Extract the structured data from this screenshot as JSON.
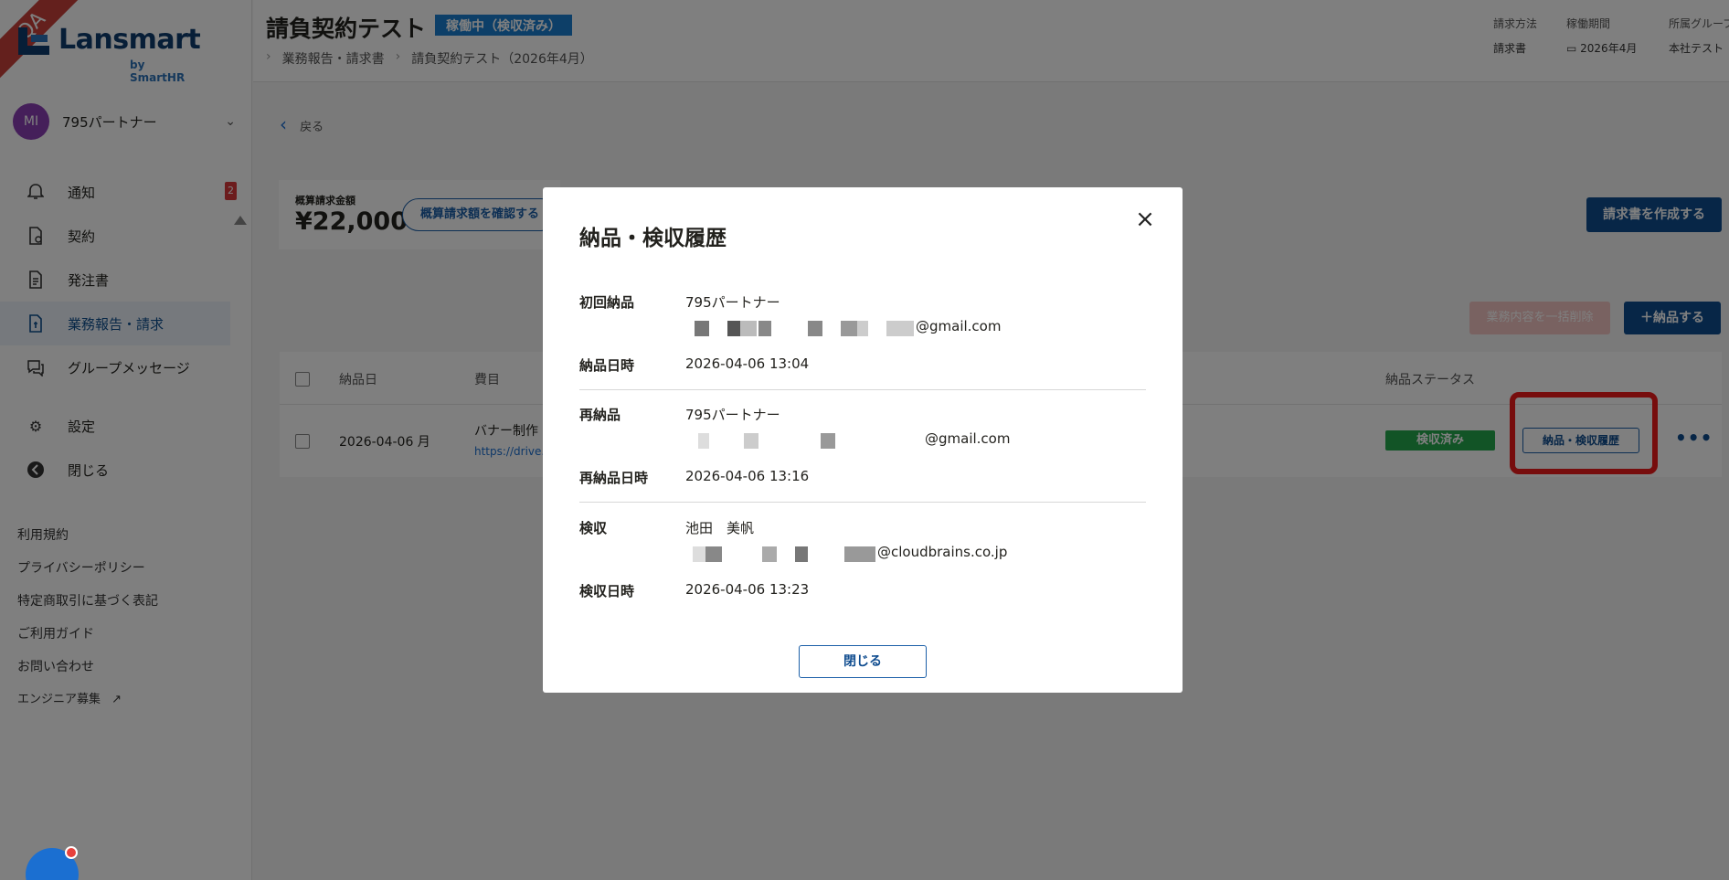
{
  "app": {
    "brand": "Lansmart",
    "brand_sub": "by SmartHR",
    "env_ribbon": "QA"
  },
  "account": {
    "initials": "MI",
    "name": "795パートナー"
  },
  "sidebar": {
    "items": [
      {
        "label": "通知",
        "icon": "bell-icon",
        "badge": "2"
      },
      {
        "label": "契約",
        "icon": "contract-icon"
      },
      {
        "label": "発注書",
        "icon": "document-icon"
      },
      {
        "label": "業務報告・請求",
        "icon": "report-icon",
        "active": true
      },
      {
        "label": "グループメッセージ",
        "icon": "chat-icon"
      },
      {
        "label": "設定",
        "icon": "gear-icon"
      },
      {
        "label": "閉じる",
        "icon": "close-circle-icon"
      }
    ],
    "links": [
      "利用規約",
      "プライバシーポリシー",
      "特定商取引に基づく表記",
      "ご利用ガイド",
      "お問い合わせ",
      "エンジニア募集"
    ]
  },
  "header": {
    "title": "請負契約テスト",
    "status": "稼働中（検収済み）",
    "breadcrumb": [
      "業務報告・請求書",
      "請負契約テスト（2026年4月）"
    ],
    "meta": [
      {
        "label": "請求方法",
        "value": "請求書"
      },
      {
        "label": "稼働期間",
        "value": "2026年4月"
      },
      {
        "label": "所属グループ",
        "value": "本社テスト"
      }
    ]
  },
  "main": {
    "back": "戻る",
    "estimate_label": "概算請求金額",
    "estimate_value": "¥22,000",
    "estimate_button": "概算請求額を確認する",
    "create_invoice": "請求書を作成する",
    "bulk_delete": "業務内容を一括削除",
    "deliver": "＋納品する",
    "table": {
      "headers": [
        "納品日",
        "費目",
        "納品ステータス"
      ],
      "row": {
        "date": "2026-04-06 月",
        "item": "バナー制作",
        "link": "https://drive.",
        "status": "検収済み",
        "history_button": "納品・検収履歴",
        "more": "•••"
      }
    }
  },
  "modal": {
    "title": "納品・検収履歴",
    "close_icon": "×",
    "sections": [
      {
        "label": "初回納品",
        "name": "795パートナー",
        "email_suffix": "@gmail.com",
        "date_label": "納品日時",
        "date": "2026-04-06 13:04"
      },
      {
        "label": "再納品",
        "name": "795パートナー",
        "email_suffix": "@gmail.com",
        "date_label": "再納品日時",
        "date": "2026-04-06 13:16"
      },
      {
        "label": "検収",
        "name": "池田　美帆",
        "email_suffix": "@cloudbrains.co.jp",
        "date_label": "検収日時",
        "date": "2026-04-06 13:23"
      }
    ],
    "close_button": "閉じる"
  },
  "colors": {
    "primary": "#0f4c8f",
    "accent_blue": "#1b7fd1",
    "success": "#24a84c",
    "highlight_red": "#ee1b1b"
  }
}
